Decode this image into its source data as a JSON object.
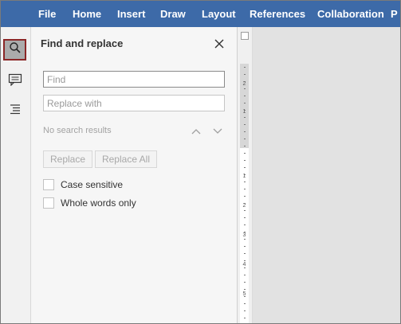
{
  "menu": [
    "File",
    "Home",
    "Insert",
    "Draw",
    "Layout",
    "References",
    "Collaboration",
    "P"
  ],
  "left_tools": [
    {
      "name": "search-tool",
      "icon": "search-icon"
    },
    {
      "name": "comments-tool",
      "icon": "comments-icon"
    },
    {
      "name": "navigation-tool",
      "icon": "navigation-icon"
    }
  ],
  "find_panel": {
    "title": "Find and replace",
    "find_placeholder": "Find",
    "find_value": "",
    "replace_placeholder": "Replace with",
    "replace_value": "",
    "no_results": "No search results",
    "replace_label": "Replace",
    "replace_all_label": "Replace All",
    "case_sensitive_label": "Case sensitive",
    "case_sensitive_checked": false,
    "whole_words_label": "Whole words only",
    "whole_words_checked": false
  },
  "ruler": {
    "labels": [
      "2",
      "1",
      "1",
      "2",
      "3",
      "4",
      "5"
    ]
  },
  "colors": {
    "menubar": "#3d6aa8",
    "active_tool_border": "#8b2727"
  }
}
